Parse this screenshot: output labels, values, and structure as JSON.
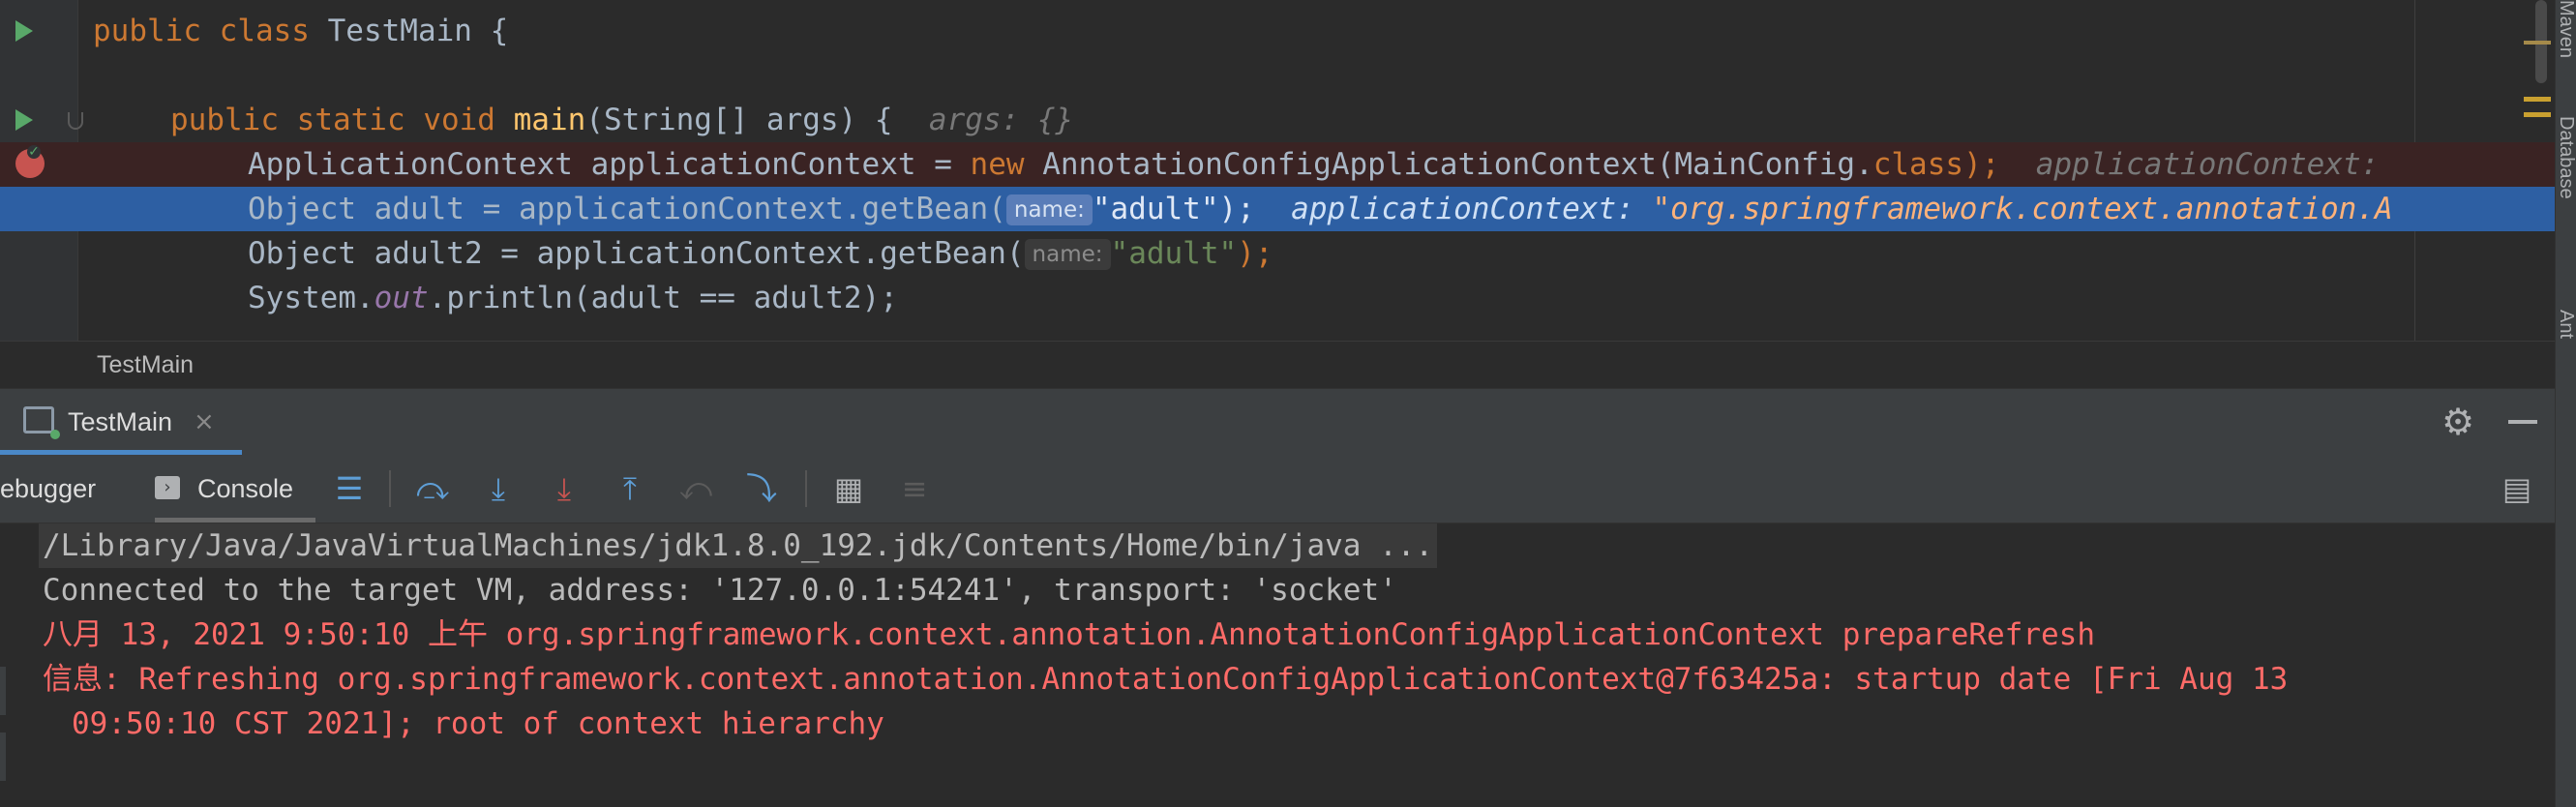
{
  "editor": {
    "lines": {
      "l1": {
        "kw1": "public ",
        "kw2": "class ",
        "text": "TestMain {"
      },
      "l2": {
        "kw1": "public ",
        "kw2": "static ",
        "kw3": "void ",
        "fn": "main",
        "text": "(String[] args) {  ",
        "hint": "args: {}"
      },
      "l3": {
        "text1": "ApplicationContext applicationContext = ",
        "kw1": "new ",
        "text2": "AnnotationConfigApplicationContext(MainConfig.",
        "kw2": "class",
        "text3": ");  ",
        "hint": "applicationContext: "
      },
      "l4": {
        "text1": "Object adult = applicationContext.getBean(",
        "param": "name:",
        "str": "\"adult\"",
        "text2": ");  ",
        "hint": "applicationContext: ",
        "val": "\"org.springframework.context.annotation.A"
      },
      "l5": {
        "text1": "Object adult2 = applicationContext.getBean(",
        "param": "name:",
        "str": "\"adult\"",
        "text2": ");"
      },
      "l6": {
        "text1": "System.",
        "field": "out",
        "text2": ".println(adult == adult2);"
      }
    },
    "breadcrumb": "TestMain"
  },
  "tool_window": {
    "run_tab_label": "TestMain",
    "run_tab_close": "×",
    "settings_icon": "⚙",
    "debugger_tab": "ebugger",
    "console_tab": "Console"
  },
  "toolbar": {
    "icons": [
      {
        "name": "threads-icon",
        "glyph": "☰",
        "color": "#5e9ed6"
      },
      {
        "name": "step-over-icon",
        "glyph": "⤼",
        "color": "#5e9ed6"
      },
      {
        "name": "step-into-icon",
        "glyph": "⤓",
        "color": "#5e9ed6"
      },
      {
        "name": "force-step-into-icon",
        "glyph": "⤓",
        "color": "#c75450"
      },
      {
        "name": "step-out-icon",
        "glyph": "⤒",
        "color": "#5e9ed6"
      },
      {
        "name": "drop-frame-icon",
        "glyph": "⤺",
        "color": "#5b5b5b"
      },
      {
        "name": "run-to-cursor-icon",
        "glyph": "⤵",
        "color": "#5e9ed6"
      },
      {
        "name": "evaluate-expression-icon",
        "glyph": "▦",
        "color": "#afb1b3"
      },
      {
        "name": "trace-icon",
        "glyph": "≡",
        "color": "#5b5b5b"
      }
    ],
    "layout_icon": "▤"
  },
  "console": {
    "cmd": "/Library/Java/JavaVirtualMachines/jdk1.8.0_192.jdk/Contents/Home/bin/java ...",
    "connected": "Connected to the target VM, address: '127.0.0.1:54241', transport: 'socket'",
    "log1": "八月 13, 2021 9:50:10 上午 org.springframework.context.annotation.AnnotationConfigApplicationContext prepareRefresh",
    "log2": "信息: Refreshing org.springframework.context.annotation.AnnotationConfigApplicationContext@7f63425a: startup date [Fri Aug 13",
    "log3": "09:50:10 CST 2021]; root of context hierarchy"
  },
  "right_stripe": {
    "top": "Maven",
    "middle": "Database",
    "bottom": "Ant"
  }
}
